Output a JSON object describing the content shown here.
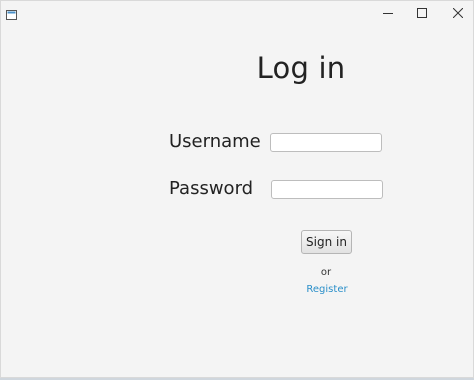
{
  "window": {
    "controls": {
      "minimize_icon": "minimize-icon",
      "maximize_icon": "maximize-icon",
      "close_icon": "close-icon"
    }
  },
  "form": {
    "title": "Log in",
    "username_label": "Username",
    "username_value": "",
    "password_label": "Password",
    "password_value": "",
    "sign_in_label": "Sign in",
    "or_text": "or",
    "register_label": "Register"
  },
  "colors": {
    "window_background": "#f4f4f4",
    "link": "#2a8fc9",
    "text": "#222222"
  }
}
